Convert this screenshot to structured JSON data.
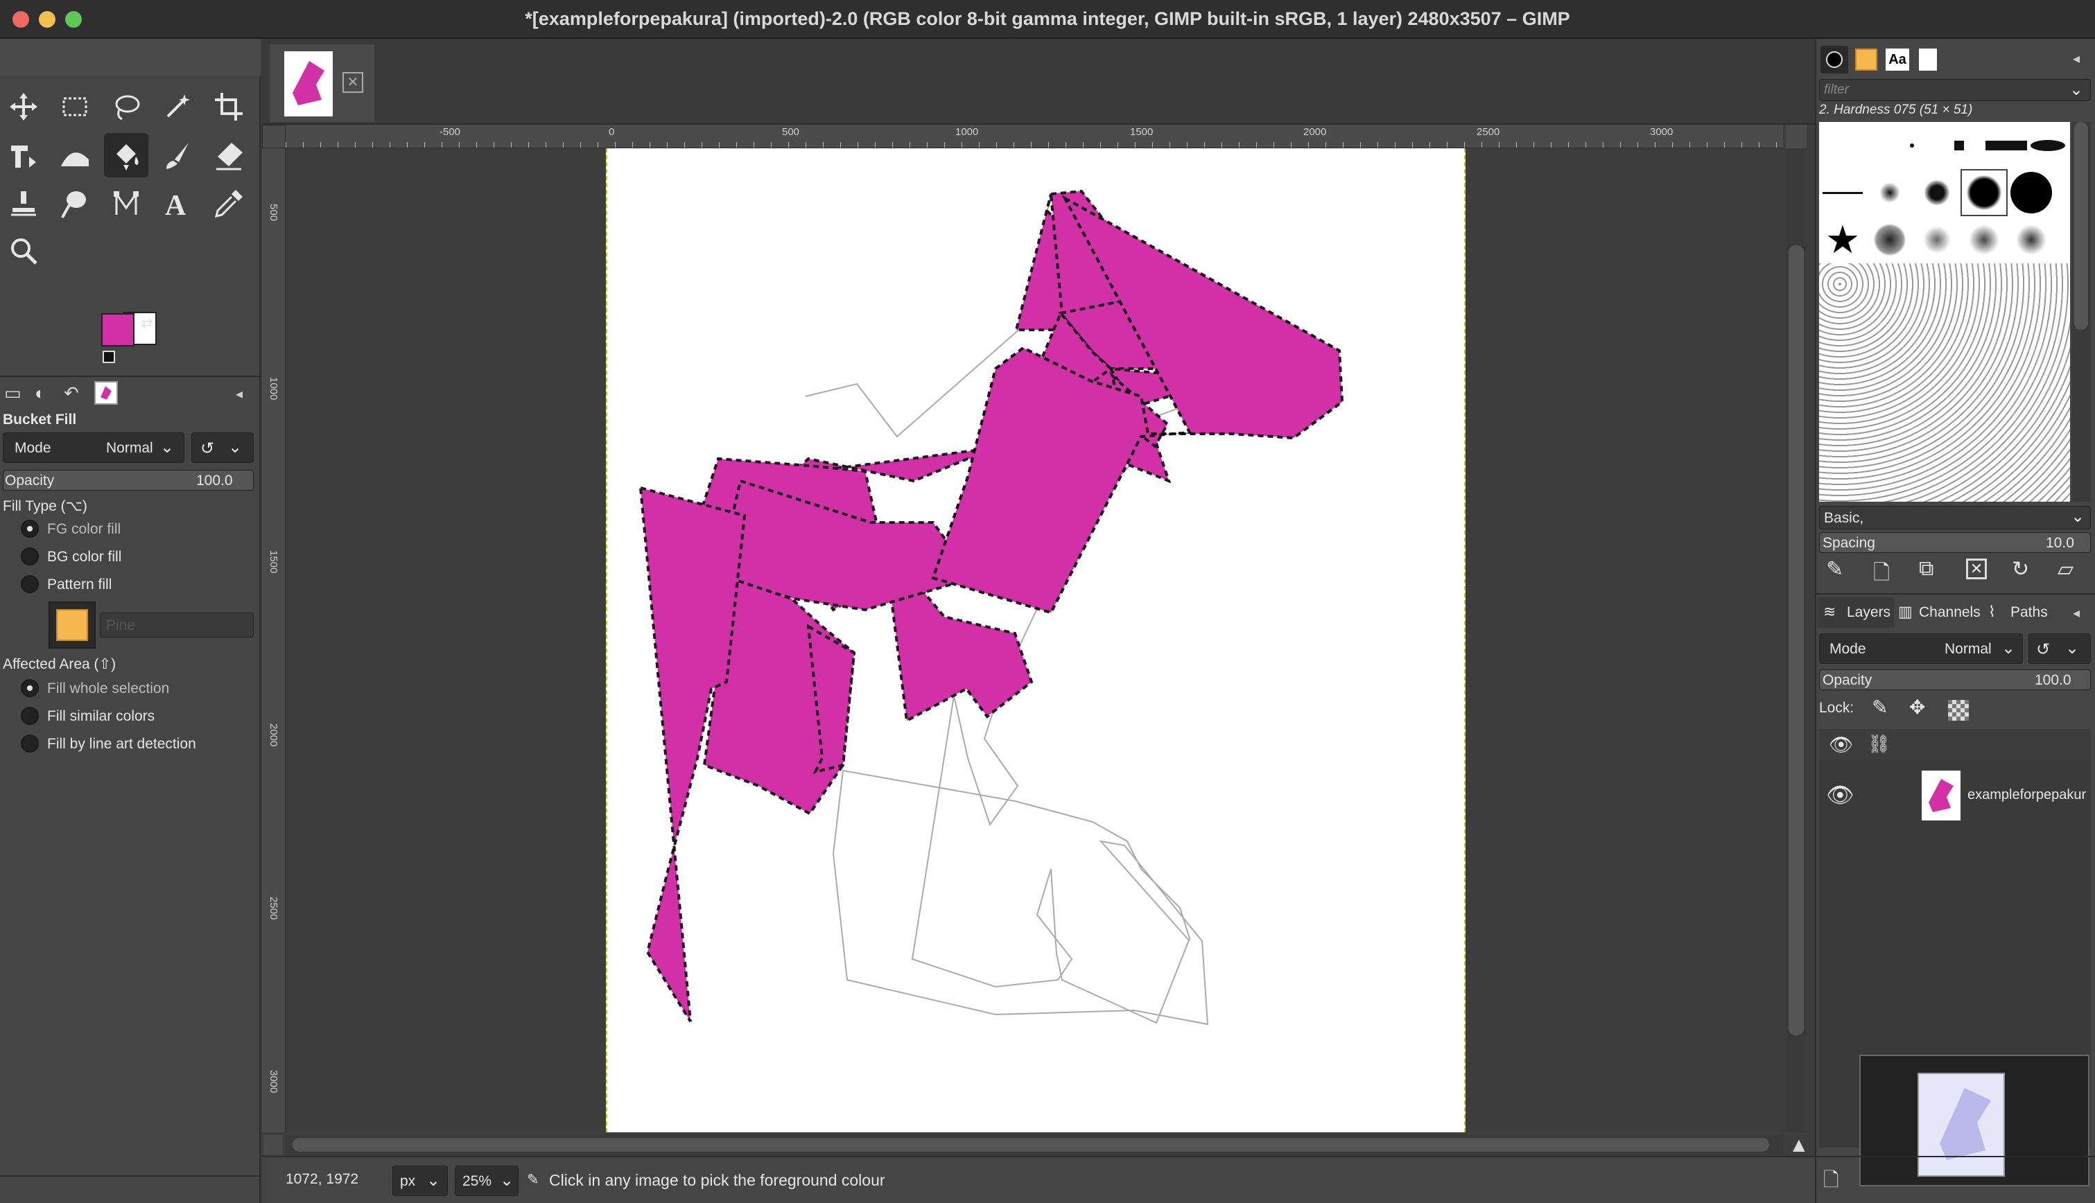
{
  "window": {
    "title": "*[exampleforpepakura] (imported)-2.0 (RGB color 8-bit gamma integer, GIMP built-in sRGB, 1 layer) 2480x3507 – GIMP"
  },
  "tab": {
    "thumbnail": "image-thumbnail"
  },
  "colors": {
    "foreground": "#d130a6",
    "background": "#ffffff",
    "fill_shape": "#d130a6"
  },
  "tool_options": {
    "title": "Bucket Fill",
    "mode_label": "Mode",
    "mode_value": "Normal",
    "opacity_label": "Opacity",
    "opacity_value": "100.0",
    "fill_type_label": "Fill Type  (⌥)",
    "fill_types": [
      "FG color fill",
      "BG color fill",
      "Pattern fill"
    ],
    "pattern_name": "Pine",
    "affected_area_label": "Affected Area  (⇧)",
    "affected_areas": [
      "Fill whole selection",
      "Fill similar colors",
      "Fill by line art detection"
    ]
  },
  "rulers": {
    "horizontal": [
      "-500",
      "0",
      "500",
      "1000",
      "1500",
      "2000",
      "2500",
      "3000"
    ],
    "vertical": [
      "500",
      "1000",
      "1500",
      "2000",
      "2500",
      "3000"
    ]
  },
  "status": {
    "coords": "1072, 1972",
    "unit": "px",
    "zoom": "25%",
    "message": "Click in any image to pick the foreground colour"
  },
  "brushes": {
    "filter_placeholder": "filter",
    "selected_name": "2. Hardness 075 (51 × 51)",
    "preset": "Basic,",
    "spacing_label": "Spacing",
    "spacing_value": "10.0"
  },
  "layers": {
    "tabs": [
      "Layers",
      "Channels",
      "Paths"
    ],
    "mode_label": "Mode",
    "mode_value": "Normal",
    "opacity_label": "Opacity",
    "opacity_value": "100.0",
    "lock_label": "Lock:",
    "items": [
      {
        "name": "exampleforpepakur"
      }
    ]
  }
}
